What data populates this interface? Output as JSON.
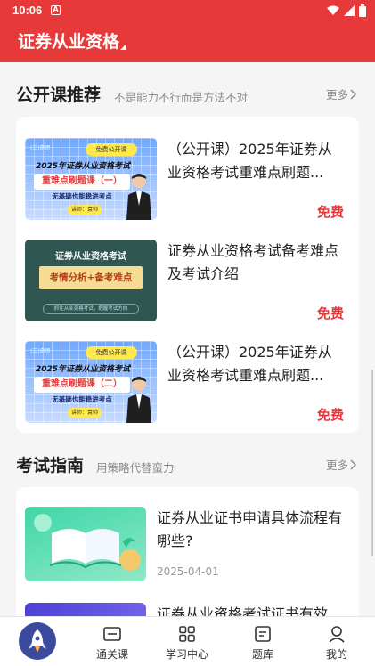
{
  "status_bar": {
    "time": "10:06",
    "app_indicator": "A"
  },
  "app_bar": {
    "title": "证券从业资格"
  },
  "open_courses": {
    "heading": "公开课推荐",
    "subheading": "不是能力不行而是方法不对",
    "more_label": "更多",
    "items": [
      {
        "title": "（公开课）2025年证券从业资格考试重难点刷题...",
        "price": "免费",
        "thumb": {
          "tag": "(三)奇思",
          "badge": "免费公开课",
          "line1": "2025年证券从业资格考试",
          "band": "重难点刷题课（一）",
          "line2": "无基础也能稳进考点",
          "lecturer": "讲师：袁帅"
        }
      },
      {
        "title": "证券从业资格考试备考难点及考试介绍",
        "price": "免费",
        "thumb": {
          "line1": "证券从业资格考试",
          "band": "考情分析+备考难点",
          "line3": "抓住从业资格考试，把握考试方向"
        }
      },
      {
        "title": "（公开课）2025年证券从业资格考试重难点刷题...",
        "price": "免费",
        "thumb": {
          "tag": "(三)奇思",
          "badge": "免费公开课",
          "line1": "2025年证券从业资格考试",
          "band": "重难点刷题课（二）",
          "line2": "无基础也能稳进考点",
          "lecturer": "讲师：袁帅"
        }
      }
    ]
  },
  "exam_guide": {
    "heading": "考试指南",
    "subheading": "用策略代替蛮力",
    "more_label": "更多",
    "items": [
      {
        "title": "证券从业证书申请具体流程有哪些?",
        "date": "2025-04-01"
      },
      {
        "title": "证券从业资格考试证书有效"
      }
    ]
  },
  "bottom_nav": {
    "items": [
      {
        "label": "通关课",
        "icon": "course-card-icon"
      },
      {
        "label": "学习中心",
        "icon": "grid-icon"
      },
      {
        "label": "题库",
        "icon": "question-bank-icon"
      },
      {
        "label": "我的",
        "icon": "user-icon"
      }
    ]
  },
  "colors": {
    "brand": "#e8393a",
    "price": "#e8393a",
    "nav_home": "#3b4a9c"
  }
}
